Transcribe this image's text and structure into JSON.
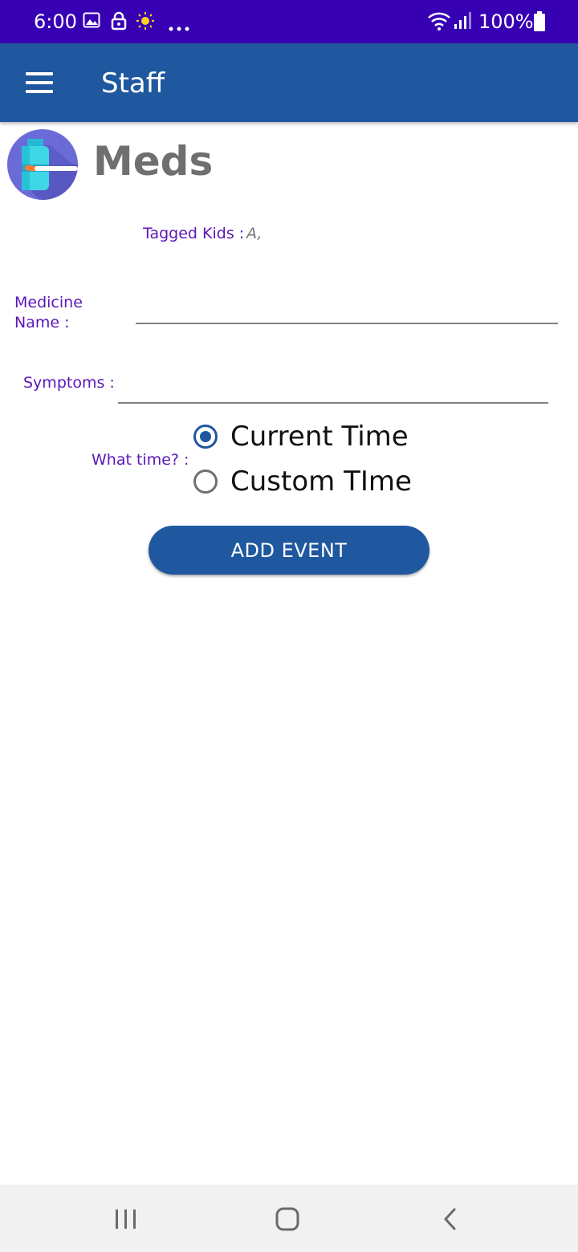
{
  "status_bar": {
    "time": "6:00",
    "battery": "100%",
    "icons": [
      "gallery-icon",
      "lock-icon",
      "brightness-icon",
      "more-dots-icon",
      "wifi-icon",
      "signal-icon",
      "battery-icon"
    ]
  },
  "app_bar": {
    "title": "Staff",
    "menu_icon": "hamburger-menu-icon"
  },
  "page": {
    "title": "Meds",
    "logo_icon": "medicine-bottle-spoon-icon"
  },
  "form": {
    "tagged_kids_label": "Tagged Kids :",
    "tagged_kids_value": "A,",
    "medicine_label_line1": "Medicine",
    "medicine_label_line2": "Name :",
    "medicine_value": "",
    "symptoms_label": "Symptoms :",
    "symptoms_value": "",
    "time_label": "What time? :",
    "time_options": [
      {
        "label": "Current Time",
        "selected": true
      },
      {
        "label": "Custom TIme",
        "selected": false
      }
    ],
    "submit_label": "ADD EVENT"
  },
  "nav_bar": {
    "buttons": [
      "recent-apps-icon",
      "home-icon",
      "back-icon"
    ]
  },
  "colors": {
    "status_bar": "#3700b3",
    "primary": "#1f589f",
    "label": "#5b16b8",
    "title_gray": "#6f6f6f"
  }
}
